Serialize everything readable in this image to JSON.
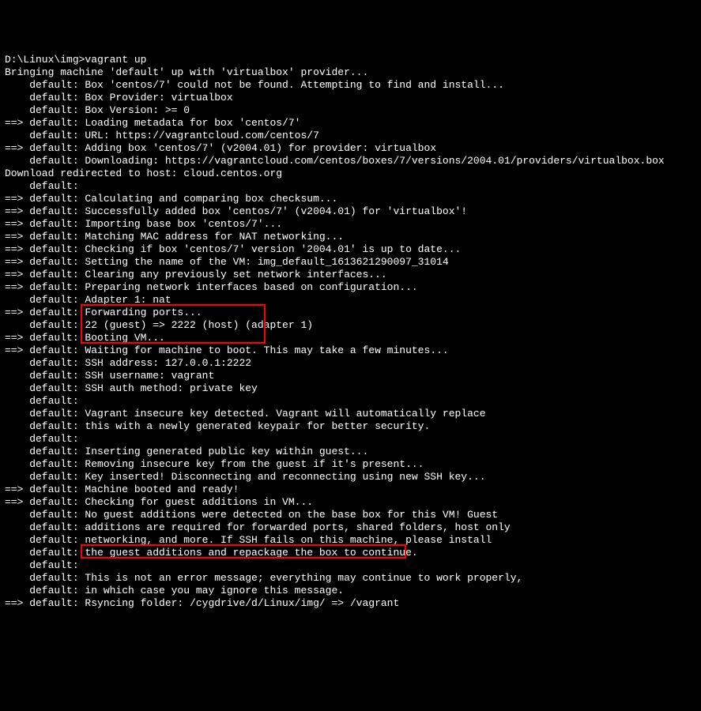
{
  "prompt": "D:\\Linux\\img>vagrant up",
  "lines": [
    "Bringing machine 'default' up with 'virtualbox' provider...",
    "    default: Box 'centos/7' could not be found. Attempting to find and install...",
    "    default: Box Provider: virtualbox",
    "    default: Box Version: >= 0",
    "==> default: Loading metadata for box 'centos/7'",
    "    default: URL: https://vagrantcloud.com/centos/7",
    "==> default: Adding box 'centos/7' (v2004.01) for provider: virtualbox",
    "    default: Downloading: https://vagrantcloud.com/centos/boxes/7/versions/2004.01/providers/virtualbox.box",
    "Download redirected to host: cloud.centos.org",
    "    default:",
    "==> default: Calculating and comparing box checksum...",
    "==> default: Successfully added box 'centos/7' (v2004.01) for 'virtualbox'!",
    "==> default: Importing base box 'centos/7'...",
    "==> default: Matching MAC address for NAT networking...",
    "==> default: Checking if box 'centos/7' version '2004.01' is up to date...",
    "==> default: Setting the name of the VM: img_default_1613621290097_31014",
    "==> default: Clearing any previously set network interfaces...",
    "==> default: Preparing network interfaces based on configuration...",
    "    default: Adapter 1: nat",
    "==> default: Forwarding ports...",
    "    default: 22 (guest) => 2222 (host) (adapter 1)",
    "==> default: Booting VM...",
    "==> default: Waiting for machine to boot. This may take a few minutes...",
    "    default: SSH address: 127.0.0.1:2222",
    "    default: SSH username: vagrant",
    "    default: SSH auth method: private key",
    "    default:",
    "    default: Vagrant insecure key detected. Vagrant will automatically replace",
    "    default: this with a newly generated keypair for better security.",
    "    default:",
    "    default: Inserting generated public key within guest...",
    "    default: Removing insecure key from the guest if it's present...",
    "    default: Key inserted! Disconnecting and reconnecting using new SSH key...",
    "==> default: Machine booted and ready!",
    "==> default: Checking for guest additions in VM...",
    "    default: No guest additions were detected on the base box for this VM! Guest",
    "    default: additions are required for forwarded ports, shared folders, host only",
    "    default: networking, and more. If SSH fails on this machine, please install",
    "    default: the guest additions and repackage the box to continue.",
    "    default:",
    "    default: This is not an error message; everything may continue to work properly,",
    "    default: in which case you may ignore this message.",
    "==> default: Rsyncing folder: /cygdrive/d/Linux/img/ => /vagrant"
  ],
  "highlight1": {
    "ssh_address": "SSH address: 127.0.0.1:2222",
    "ssh_username": "SSH username: vagrant",
    "ssh_auth": "SSH auth method: private key"
  },
  "highlight2": {
    "rsync": "Rsyncing folder: /cygdrive/d/Linux/img/ => /vagrant"
  }
}
